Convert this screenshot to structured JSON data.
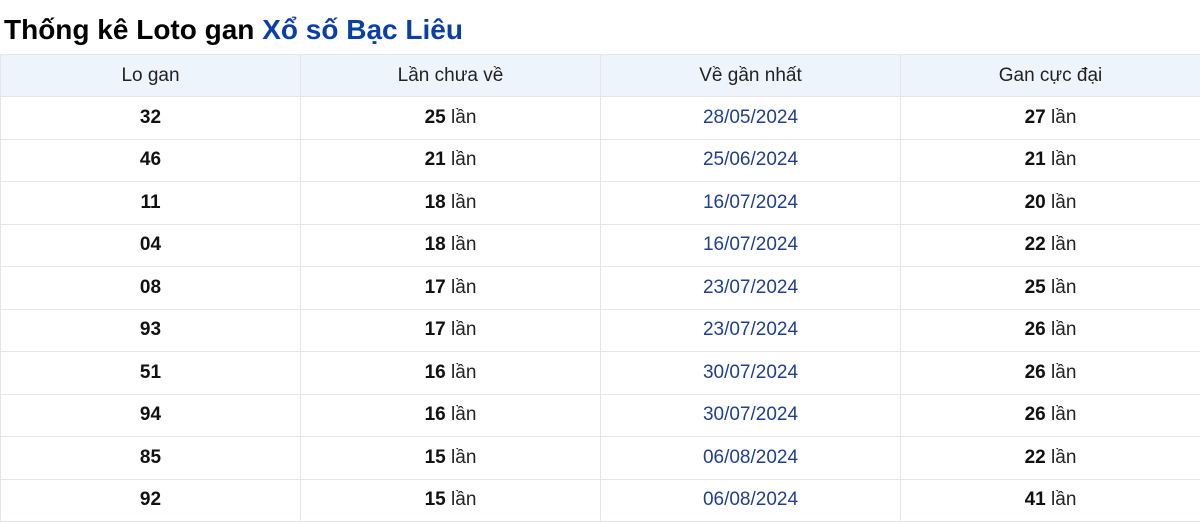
{
  "title": {
    "part1": "Thống kê Loto gan",
    "part2": "Xổ số Bạc Liêu"
  },
  "table": {
    "headers": [
      "Lo gan",
      "Lần chưa về",
      "Về gần nhất",
      "Gan cực đại"
    ],
    "unit": "lần",
    "rows": [
      {
        "number": "32",
        "missing": "25",
        "last_seen": "28/05/2024",
        "max_gap": "27"
      },
      {
        "number": "46",
        "missing": "21",
        "last_seen": "25/06/2024",
        "max_gap": "21"
      },
      {
        "number": "11",
        "missing": "18",
        "last_seen": "16/07/2024",
        "max_gap": "20"
      },
      {
        "number": "04",
        "missing": "18",
        "last_seen": "16/07/2024",
        "max_gap": "22"
      },
      {
        "number": "08",
        "missing": "17",
        "last_seen": "23/07/2024",
        "max_gap": "25"
      },
      {
        "number": "93",
        "missing": "17",
        "last_seen": "23/07/2024",
        "max_gap": "26"
      },
      {
        "number": "51",
        "missing": "16",
        "last_seen": "30/07/2024",
        "max_gap": "26"
      },
      {
        "number": "94",
        "missing": "16",
        "last_seen": "30/07/2024",
        "max_gap": "26"
      },
      {
        "number": "85",
        "missing": "15",
        "last_seen": "06/08/2024",
        "max_gap": "22"
      },
      {
        "number": "92",
        "missing": "15",
        "last_seen": "06/08/2024",
        "max_gap": "41"
      }
    ]
  },
  "colors": {
    "title_accent": "#0a3fa6",
    "header_bg": "#eef4fb",
    "date_text": "#1f3f8f",
    "border": "#e3e6ea"
  }
}
